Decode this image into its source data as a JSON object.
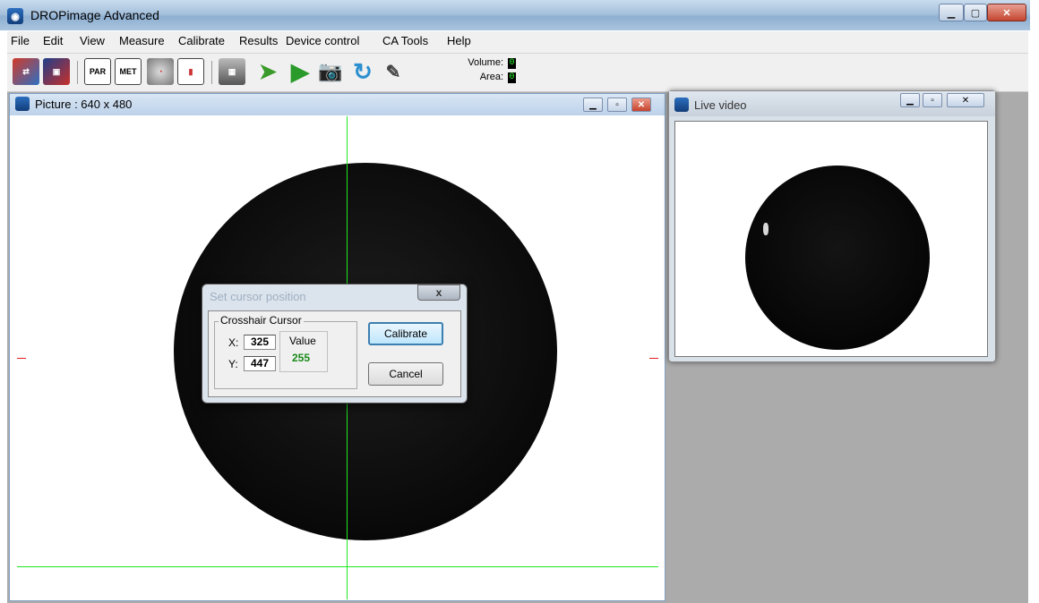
{
  "app": {
    "title": "DROPimage Advanced"
  },
  "menu": [
    "File",
    "Edit",
    "View",
    "Measure",
    "Calibrate",
    "Results",
    "Device control",
    "CA Tools",
    "Help"
  ],
  "toolbar": {
    "icon_texts": {
      "par": "PAR",
      "met": "MET"
    },
    "status": {
      "volume_label": "Volume:",
      "volume_value": "0",
      "area_label": "Area:",
      "area_value": "0"
    }
  },
  "picture_window": {
    "title": "Picture : 640 x 480"
  },
  "live_window": {
    "title": "Live video"
  },
  "dialog": {
    "title": "Set cursor position",
    "close_label": "x",
    "group_label": "Crosshair Cursor",
    "x_label": "X:",
    "x_value": "325",
    "y_label": "Y:",
    "y_value": "447",
    "value_label": "Value",
    "value": "255",
    "calibrate_label": "Calibrate",
    "cancel_label": "Cancel"
  },
  "colors": {
    "crosshair": "#1fe81f",
    "tick_marks": "#e41e1e",
    "value_text": "#1a8a1a"
  }
}
